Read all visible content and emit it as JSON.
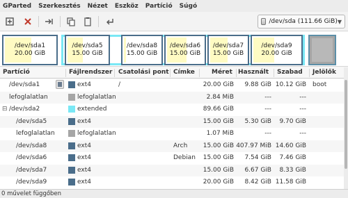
{
  "menu": [
    "GParted",
    "Szerkesztés",
    "Nézet",
    "Eszköz",
    "Partíció",
    "Súgó"
  ],
  "toolbar": {
    "icons": [
      "new-partition-icon",
      "delete-icon",
      "resize-move-icon",
      "copy-icon",
      "paste-icon",
      "undo-icon"
    ]
  },
  "device": {
    "label": "/dev/sda  (111.66 GiB)"
  },
  "diskmap": [
    {
      "name": "/dev/sda1",
      "size": "20.00 GiB"
    },
    {
      "name": "/dev/sda5",
      "size": "15.00 GiB"
    },
    {
      "name": "/dev/sda8",
      "size": "15.00 GiB"
    },
    {
      "name": "/dev/sda6",
      "size": "15.00 GiB"
    },
    {
      "name": "/dev/sda7",
      "size": "15.00 GiB"
    },
    {
      "name": "/dev/sda9",
      "size": "20.00 GiB"
    }
  ],
  "columns": [
    "Partíció",
    "Fájlrendszer",
    "Csatolási pont",
    "Címke",
    "Méret",
    "Használt",
    "Szabad",
    "Jelölők"
  ],
  "rows": [
    {
      "partition": "/dev/sda1",
      "fs": "ext4",
      "mount": "/",
      "label": "",
      "size": "20.00 GiB",
      "used": "9.88 GiB",
      "free": "10.12 GiB",
      "flags": "boot",
      "color": "#4a6d8a",
      "locked": true
    },
    {
      "partition": "lefoglalatlan",
      "fs": "lefoglalatlan",
      "mount": "",
      "label": "",
      "size": "2.84 MiB",
      "used": "---",
      "free": "---",
      "flags": "",
      "color": "#a6a6a6",
      "locked": false
    },
    {
      "partition": "/dev/sda2",
      "fs": "extended",
      "mount": "",
      "label": "",
      "size": "89.66 GiB",
      "used": "---",
      "free": "---",
      "flags": "",
      "color": "#7ae8f5",
      "locked": false,
      "expander": "⊟"
    },
    {
      "partition": "/dev/sda5",
      "fs": "ext4",
      "mount": "",
      "label": "",
      "size": "15.00 GiB",
      "used": "5.30 GiB",
      "free": "9.70 GiB",
      "flags": "",
      "color": "#4a6d8a",
      "locked": false
    },
    {
      "partition": "lefoglalatlan",
      "fs": "lefoglalatlan",
      "mount": "",
      "label": "",
      "size": "1.07 MiB",
      "used": "---",
      "free": "---",
      "flags": "",
      "color": "#a6a6a6",
      "locked": false
    },
    {
      "partition": "/dev/sda8",
      "fs": "ext4",
      "mount": "",
      "label": "Arch",
      "size": "15.00 GiB",
      "used": "407.97 MiB",
      "free": "14.60 GiB",
      "flags": "",
      "color": "#4a6d8a",
      "locked": false
    },
    {
      "partition": "/dev/sda6",
      "fs": "ext4",
      "mount": "",
      "label": "Debian",
      "size": "15.00 GiB",
      "used": "7.54 GiB",
      "free": "7.46 GiB",
      "flags": "",
      "color": "#4a6d8a",
      "locked": false
    },
    {
      "partition": "/dev/sda7",
      "fs": "ext4",
      "mount": "",
      "label": "",
      "size": "15.00 GiB",
      "used": "6.67 GiB",
      "free": "8.33 GiB",
      "flags": "",
      "color": "#4a6d8a",
      "locked": false
    },
    {
      "partition": "/dev/sda9",
      "fs": "ext4",
      "mount": "",
      "label": "",
      "size": "20.00 GiB",
      "used": "8.42 GiB",
      "free": "11.58 GiB",
      "flags": "",
      "color": "#4a6d8a",
      "locked": false
    }
  ],
  "status": "0 művelet függőben",
  "colors": {
    "ext4": "#4a6d8a",
    "unallocated": "#a6a6a6",
    "extended": "#7ae8f5",
    "used": "#fffbc3"
  }
}
